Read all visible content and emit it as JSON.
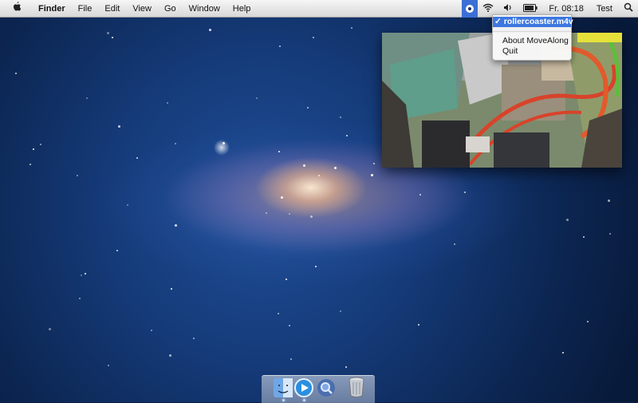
{
  "menubar": {
    "apple_icon": "apple-logo-icon",
    "app_name": "Finder",
    "menus": [
      "File",
      "Edit",
      "View",
      "Go",
      "Window",
      "Help"
    ],
    "status_icons": [
      "movealong-eye-icon",
      "wifi-icon",
      "volume-icon",
      "battery-icon"
    ],
    "clock": "Fr. 08:18",
    "user": "Test",
    "spotlight_icon": "search-icon"
  },
  "status_menu": {
    "checkmark": "✓",
    "selected_item": "rollercoaster.m4v",
    "items": [
      "About MoveAlong",
      "Quit"
    ]
  },
  "dock": {
    "items": [
      "finder-icon",
      "quicktime-icon",
      "preview-magnifier-icon",
      "trash-icon"
    ]
  },
  "colors": {
    "menu_highlight": "#3d77e0",
    "menubar_bg": "#e6e6e6"
  }
}
